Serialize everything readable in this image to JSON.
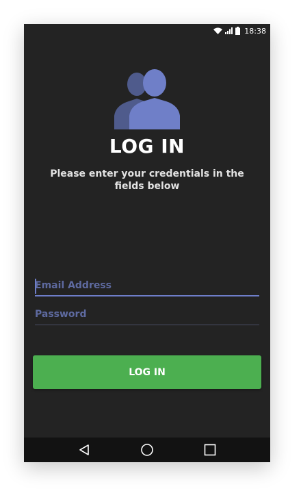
{
  "status_bar": {
    "time": "18:38",
    "icons": [
      "wifi-icon",
      "signal-icon",
      "battery-icon"
    ]
  },
  "header": {
    "icon": "users-icon",
    "title": "LOG IN",
    "subtitle": "Please enter your credentials in the fields below"
  },
  "form": {
    "email": {
      "placeholder": "Email Address",
      "value": ""
    },
    "password": {
      "placeholder": "Password",
      "value": ""
    },
    "submit_label": "LOG IN"
  },
  "nav_bar": {
    "buttons": [
      "back-icon",
      "home-icon",
      "recent-apps-icon"
    ]
  },
  "colors": {
    "background": "#232323",
    "accent": "#6e7ec9",
    "button": "#4caf50",
    "nav_bar": "#121212"
  }
}
